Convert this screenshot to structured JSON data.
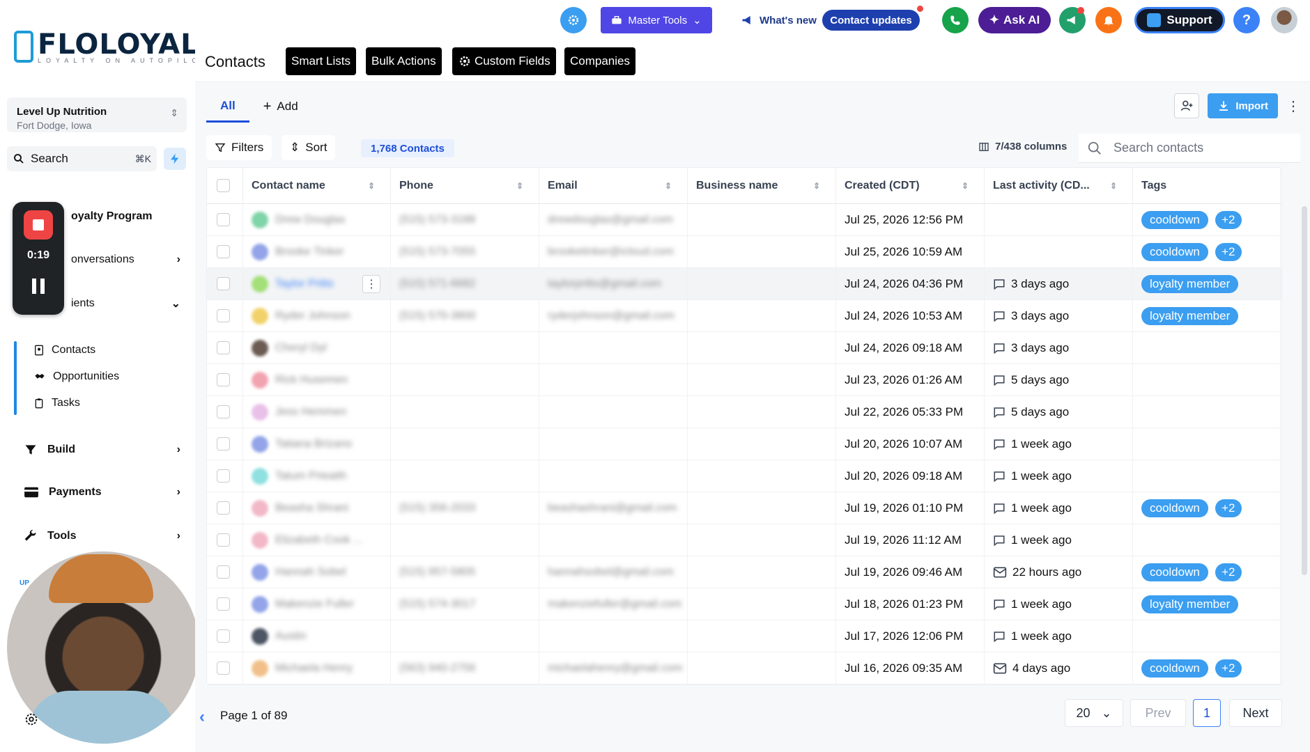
{
  "brand": {
    "name": "FLOLOYAL",
    "tagline": "LOYALTY ON AUTOPILOT"
  },
  "account": {
    "name": "Level Up Nutrition",
    "location": "Fort Dodge, Iowa"
  },
  "sidebar": {
    "search_label": "Search",
    "search_shortcut": "⌘K",
    "nav": [
      {
        "label": "oyalty Program"
      },
      {
        "label": "onversations"
      },
      {
        "label": "ients"
      }
    ],
    "sub": [
      {
        "label": "Contacts"
      },
      {
        "label": "Opportunities"
      },
      {
        "label": "Tasks"
      }
    ],
    "bottom": [
      {
        "label": "Build"
      },
      {
        "label": "Payments"
      },
      {
        "label": "Tools"
      }
    ],
    "upgrade": "UP"
  },
  "recorder": {
    "time": "0:19"
  },
  "topbar": {
    "master_tools": "Master Tools",
    "whats_new": "What's new",
    "contact_updates": "Contact updates",
    "ask_ai": "Ask AI",
    "support": "Support",
    "help": "?",
    "colors": {
      "indigo": "#4f46e5",
      "blue": "#3b9ef0",
      "green": "#16a34a"
    }
  },
  "header": {
    "title": "Contacts",
    "buttons": [
      "Smart Lists",
      "Bulk Actions",
      "Custom Fields",
      "Companies"
    ]
  },
  "tabs": {
    "all": "All",
    "add": "Add"
  },
  "toolbar": {
    "import": "Import",
    "filters": "Filters",
    "sort": "Sort",
    "contacts_count": "1,768 Contacts",
    "columns": "7/438 columns",
    "search_placeholder": "Search contacts"
  },
  "table": {
    "columns": [
      "Contact name",
      "Phone",
      "Email",
      "Business name",
      "Created (CDT)",
      "Last activity (CD...",
      "Tags"
    ],
    "rows": [
      {
        "name": "Drew Douglas",
        "phone": "(515) 573-3188",
        "email": "drewdouglas@gmail.com",
        "created": "Jul 25, 2026 12:56 PM",
        "activity": "",
        "act_icon": "",
        "tags": [
          "cooldown",
          "+2"
        ],
        "av": "#7fd4a8"
      },
      {
        "name": "Brooke Tinker",
        "phone": "(515) 573-7055",
        "email": "brooketinker@icloud.com",
        "created": "Jul 25, 2026 10:59 AM",
        "activity": "",
        "act_icon": "",
        "tags": [
          "cooldown",
          "+2"
        ],
        "av": "#93a4e8"
      },
      {
        "name": "Taylor Pritts",
        "phone": "(515) 571-6682",
        "email": "taylorpritts@gmail.com",
        "created": "Jul 24, 2026 04:36 PM",
        "activity": "3 days ago",
        "act_icon": "chat",
        "tags": [
          "loyalty member"
        ],
        "av": "#a3e07a",
        "hl": true
      },
      {
        "name": "Ryder Johnson",
        "phone": "(515) 570-3800",
        "email": "ryderjohnson@gmail.com",
        "created": "Jul 24, 2026 10:53 AM",
        "activity": "3 days ago",
        "act_icon": "chat",
        "tags": [
          "loyalty member"
        ],
        "av": "#f1d26a"
      },
      {
        "name": "Cheryl Dyl",
        "phone": "",
        "email": "",
        "created": "Jul 24, 2026 09:18 AM",
        "activity": "3 days ago",
        "act_icon": "chat",
        "tags": [],
        "av": "#6b5b52"
      },
      {
        "name": "Rick Husemen",
        "phone": "",
        "email": "",
        "created": "Jul 23, 2026 01:26 AM",
        "activity": "5 days ago",
        "act_icon": "chat",
        "tags": [],
        "av": "#f2a3b0"
      },
      {
        "name": "Jess Hemmen",
        "phone": "",
        "email": "",
        "created": "Jul 22, 2026 05:33 PM",
        "activity": "5 days ago",
        "act_icon": "chat",
        "tags": [],
        "av": "#e9c0e8"
      },
      {
        "name": "Tatiana Brizano",
        "phone": "",
        "email": "",
        "created": "Jul 20, 2026 10:07 AM",
        "activity": "1 week ago",
        "act_icon": "chat",
        "tags": [],
        "av": "#93a4e8"
      },
      {
        "name": "Tatum Prieaith",
        "phone": "",
        "email": "",
        "created": "Jul 20, 2026 09:18 AM",
        "activity": "1 week ago",
        "act_icon": "chat",
        "tags": [],
        "av": "#8fe0e0"
      },
      {
        "name": "Beasha Shrani",
        "phone": "(515) 356-2033",
        "email": "beashashrani@gmail.com",
        "created": "Jul 19, 2026 01:10 PM",
        "activity": "1 week ago",
        "act_icon": "chat",
        "tags": [
          "cooldown",
          "+2"
        ],
        "av": "#f2b8c8"
      },
      {
        "name": "Elizabeth Cook ...",
        "phone": "",
        "email": "",
        "created": "Jul 19, 2026 11:12 AM",
        "activity": "1 week ago",
        "act_icon": "chat",
        "tags": [],
        "av": "#f2b8c8"
      },
      {
        "name": "Hannah Sobel",
        "phone": "(515) 957-5805",
        "email": "hannahsobel@gmail.com",
        "created": "Jul 19, 2026 09:46 AM",
        "activity": "22 hours ago",
        "act_icon": "mail",
        "tags": [
          "cooldown",
          "+2"
        ],
        "av": "#93a4e8"
      },
      {
        "name": "Makenzie Fuller",
        "phone": "(515) 574-3017",
        "email": "makenziefuller@gmail.com",
        "created": "Jul 18, 2026 01:23 PM",
        "activity": "1 week ago",
        "act_icon": "chat",
        "tags": [
          "loyalty member"
        ],
        "av": "#93a4e8"
      },
      {
        "name": "Austin",
        "phone": "",
        "email": "",
        "created": "Jul 17, 2026 12:06 PM",
        "activity": "1 week ago",
        "act_icon": "chat",
        "tags": [],
        "av": "#4b5563"
      },
      {
        "name": "Michaela Henry",
        "phone": "(563) 940-2756",
        "email": "michaelahenry@gmail.com",
        "created": "Jul 16, 2026 09:35 AM",
        "activity": "4 days ago",
        "act_icon": "mail",
        "tags": [
          "cooldown",
          "+2"
        ],
        "av": "#f1c08a"
      }
    ]
  },
  "pagination": {
    "info": "Page 1 of 89",
    "per_page": "20",
    "prev": "Prev",
    "current": "1",
    "next": "Next"
  }
}
